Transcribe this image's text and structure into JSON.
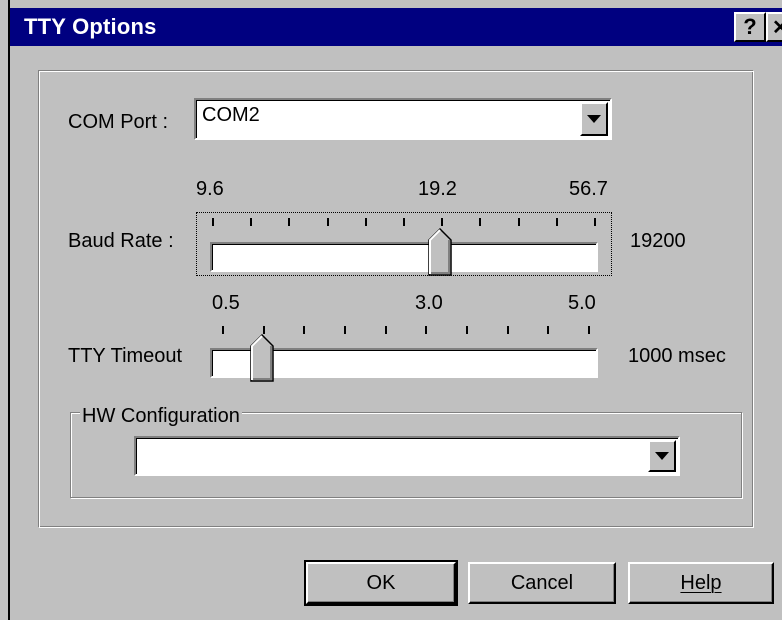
{
  "window": {
    "title": "TTY Options",
    "help_glyph": "?",
    "close_glyph": "✕"
  },
  "com_port": {
    "label": "COM Port :",
    "value": "COM2"
  },
  "baud_rate": {
    "label": "Baud Rate :",
    "ticks": [
      "9.6",
      "19.2",
      "56.7"
    ],
    "value_text": "19200",
    "position": 0.6
  },
  "tty_timeout": {
    "label": "TTY Timeout",
    "ticks": [
      "0.5",
      "3.0",
      "5.0"
    ],
    "value_text": "1000 msec",
    "position": 0.1
  },
  "hw_config": {
    "legend": "HW Configuration",
    "value": ""
  },
  "buttons": {
    "ok": "OK",
    "cancel": "Cancel",
    "help": "Help"
  }
}
